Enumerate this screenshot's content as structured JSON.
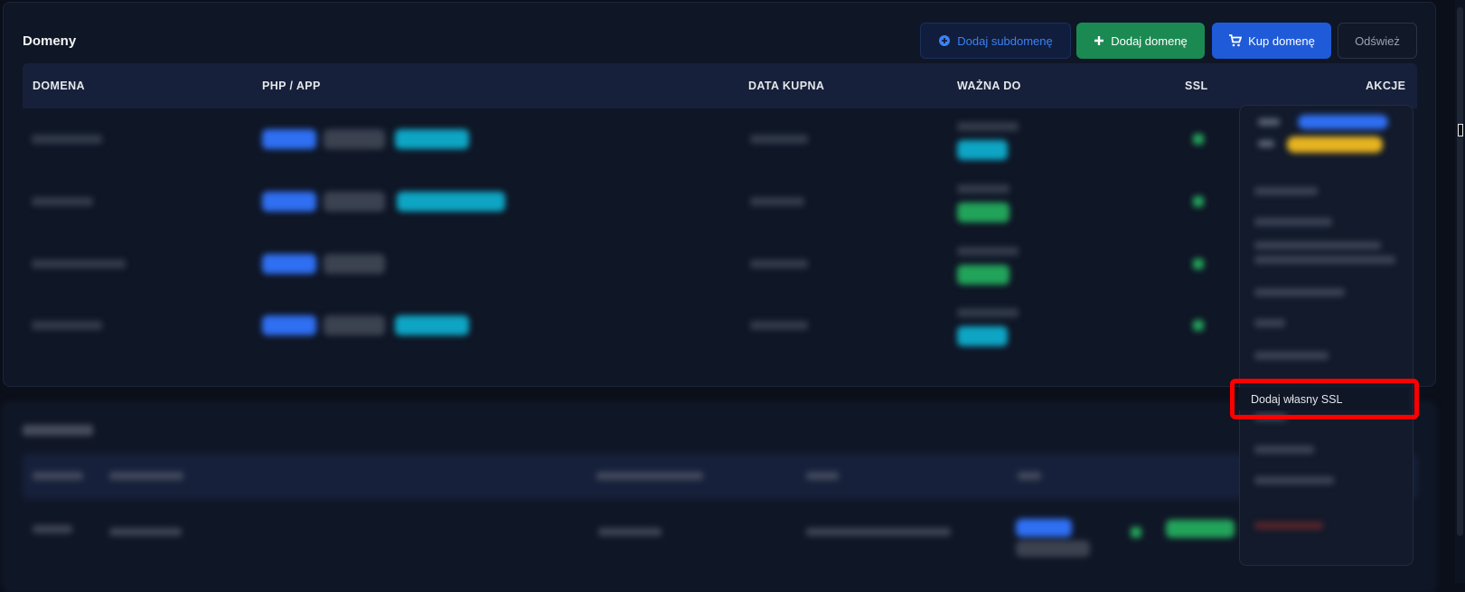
{
  "domains_panel": {
    "title": "Domeny",
    "buttons": {
      "add_subdomain": "Dodaj subdomenę",
      "add_domain": "Dodaj domenę",
      "buy_domain": "Kup domenę",
      "refresh": "Odśwież"
    },
    "columns": [
      "DOMENA",
      "PHP / APP",
      "DATA KUPNA",
      "WAŻNA DO",
      "SSL",
      "AKCJE"
    ]
  },
  "actions_menu": {
    "highlighted_item": "Dodaj własny SSL"
  },
  "colors": {
    "add_domain": "#1b8a52",
    "buy_domain": "#1f5bd8",
    "add_subdomain_text": "#3b82f6",
    "highlight": "#ff0000"
  }
}
